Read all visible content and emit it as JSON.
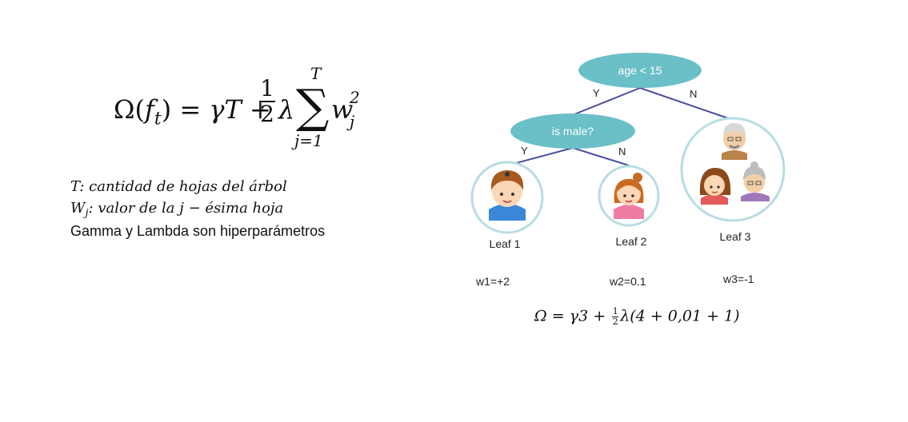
{
  "formula": {
    "lhs": "Ω(",
    "f": "f",
    "t": "t",
    "close_eq": ") = ",
    "gamma_T": "γT + ",
    "half_num": "1",
    "half_den": "2",
    "lambda": "λ",
    "sum_top": "T",
    "sum_symbol": "∑",
    "sum_bottom": "j=1",
    "w": "w",
    "w_sub": "j",
    "w_sup": "2"
  },
  "definitions": {
    "t_def": "T: cantidad de hojas del árbol",
    "w_sym": "W",
    "w_sub": "j",
    "w_def": ": valor de la j − ésima hoja",
    "note": "Gamma y Lambda son hiperparámetros"
  },
  "tree": {
    "root_label": "age < 15",
    "root_yes": "Y",
    "root_no": "N",
    "child_label": "is male?",
    "child_yes": "Y",
    "child_no": "N",
    "node_color": "#6bbfc7",
    "edge_color": "#4a4ea0",
    "leaves": [
      {
        "label": "Leaf 1",
        "weight": "w1=+2"
      },
      {
        "label": "Leaf 2",
        "weight": "w2=0.1"
      },
      {
        "label": "Leaf 3",
        "weight": "w3=-1"
      }
    ]
  },
  "bottom_formula": {
    "lhs": "Ω = γ3 + ",
    "frac_num": "1",
    "frac_den": "2",
    "rhs": "λ(4 + 0,01 + 1)"
  }
}
